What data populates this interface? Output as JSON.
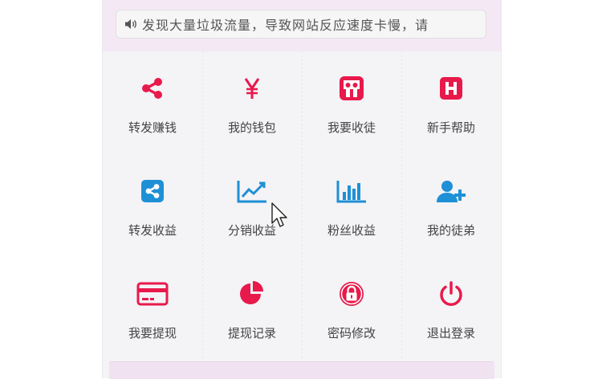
{
  "notice": {
    "text": "发现大量垃圾流量，导致网站反应速度卡慢，请",
    "icon": "volume-icon"
  },
  "colors": {
    "red": "#e8194b",
    "blue": "#1e90d6"
  },
  "menu": [
    {
      "label": "转发赚钱",
      "icon": "share-icon"
    },
    {
      "label": "我的钱包",
      "icon": "yen-icon"
    },
    {
      "label": "我要收徒",
      "icon": "slideshare-icon"
    },
    {
      "label": "新手帮助",
      "icon": "h-square-icon"
    },
    {
      "label": "转发收益",
      "icon": "share-square-icon"
    },
    {
      "label": "分销收益",
      "icon": "line-chart-icon"
    },
    {
      "label": "粉丝收益",
      "icon": "bar-chart-icon"
    },
    {
      "label": "我的徒弟",
      "icon": "user-plus-icon"
    },
    {
      "label": "我要提现",
      "icon": "credit-card-icon"
    },
    {
      "label": "提现记录",
      "icon": "pie-chart-icon"
    },
    {
      "label": "密码修改",
      "icon": "lock-icon"
    },
    {
      "label": "退出登录",
      "icon": "power-icon"
    }
  ]
}
